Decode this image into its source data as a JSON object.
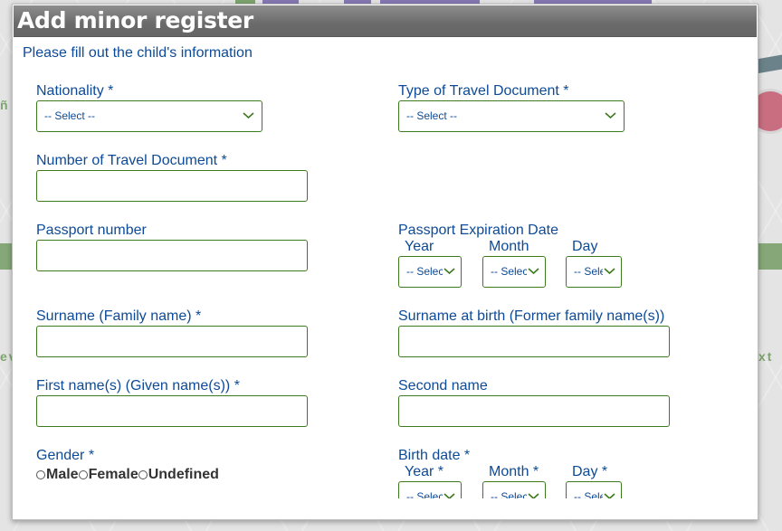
{
  "modal": {
    "title": "Add minor register",
    "intro": "Please fill out the child's information"
  },
  "background": {
    "left_text_1": "ñ",
    "left_text_2": "ev",
    "right_text": "xt"
  },
  "fields": {
    "nationality": {
      "label": "Nationality *",
      "value": "-- Select --"
    },
    "travel_doc_type": {
      "label": "Type of Travel Document *",
      "value": "-- Select --"
    },
    "travel_doc_number": {
      "label": "Number of Travel Document *",
      "value": ""
    },
    "passport_number": {
      "label": "Passport number",
      "value": ""
    },
    "passport_expiration": {
      "label": "Passport Expiration Date",
      "year_label": "Year",
      "month_label": "Month",
      "day_label": "Day",
      "year_value": "-- Select --",
      "month_value": "-- Select --",
      "day_value": "-- Select --"
    },
    "surname": {
      "label": "Surname (Family name) *",
      "value": ""
    },
    "surname_at_birth": {
      "label": "Surname at birth (Former family name(s))",
      "value": ""
    },
    "first_name": {
      "label": "First name(s) (Given name(s)) *",
      "value": ""
    },
    "second_name": {
      "label": "Second name",
      "value": ""
    },
    "gender": {
      "label": "Gender *",
      "options": [
        "Male",
        "Female",
        "Undefined"
      ],
      "selected": null
    },
    "birth_date": {
      "label": "Birth date *",
      "year_label": "Year *",
      "month_label": "Month *",
      "day_label": "Day *",
      "year_value": "-- Select --",
      "month_value": "-- Select --",
      "day_value": "-- Select --"
    }
  },
  "colors": {
    "label_blue": "#0d4a97",
    "field_border_green": "#3d7a1d",
    "title_bar_gray": "#6a6a6a"
  }
}
